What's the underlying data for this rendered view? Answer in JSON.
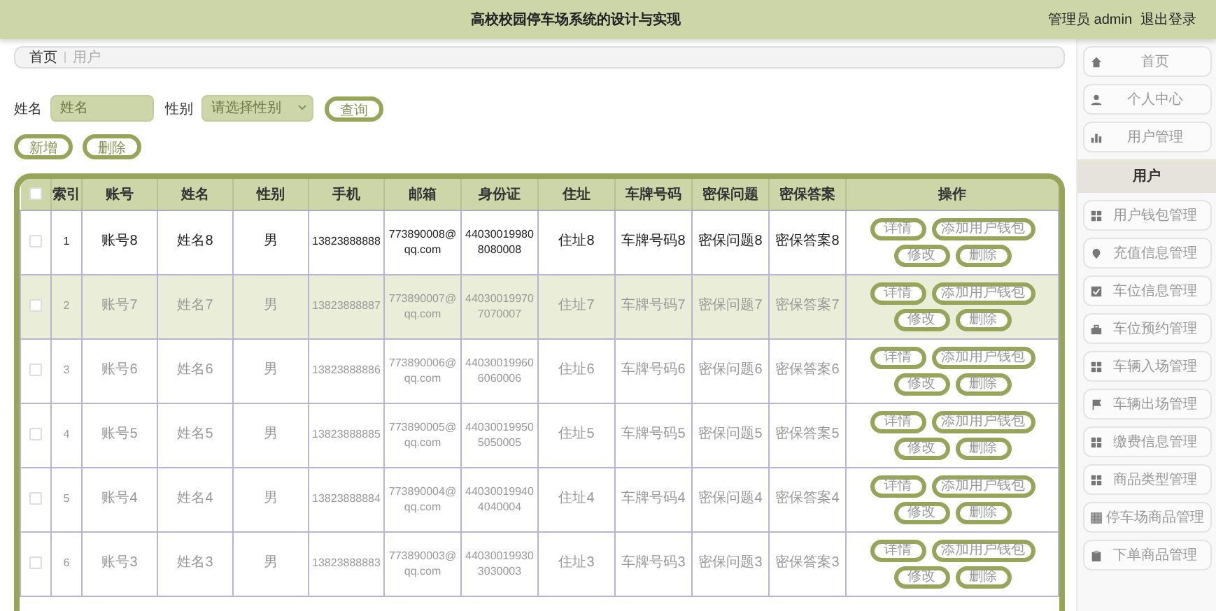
{
  "header": {
    "title": "高校校园停车场系统的设计与实现",
    "user_label": "管理员 admin",
    "logout": "退出登录"
  },
  "breadcrumb": [
    {
      "label": "首页"
    },
    {
      "label": "用户"
    }
  ],
  "search": {
    "fields": [
      {
        "kind": "text",
        "label": "姓名",
        "placeholder": "姓名"
      },
      {
        "kind": "select",
        "label": "性别",
        "placeholder": "请选择性别"
      }
    ],
    "button": "查询"
  },
  "actions": [
    "新增",
    "删除"
  ],
  "table": {
    "select_all": {
      "checked": false
    },
    "columns": [
      "索引",
      "账号",
      "姓名",
      "性别",
      "手机",
      "邮箱",
      "身份证",
      "住址",
      "车牌号码",
      "密保问题",
      "密保答案",
      "操作"
    ],
    "rows": [
      {
        "checked": false,
        "highlighted": true,
        "shaded": false,
        "cells": [
          "1",
          "账号8",
          "姓名8",
          "男",
          "13823888888",
          "773890008@qq.com",
          "440300199808080008",
          "住址8",
          "车牌号码8",
          "密保问题8",
          "密保答案8"
        ],
        "buttons": [
          "详情",
          "添加用户钱包",
          "修改",
          "删除"
        ]
      },
      {
        "checked": false,
        "highlighted": false,
        "shaded": true,
        "cells": [
          "2",
          "账号7",
          "姓名7",
          "男",
          "13823888887",
          "773890007@qq.com",
          "440300199707070007",
          "住址7",
          "车牌号码7",
          "密保问题7",
          "密保答案7"
        ],
        "buttons": [
          "详情",
          "添加用户钱包",
          "修改",
          "删除"
        ]
      },
      {
        "checked": false,
        "highlighted": false,
        "shaded": false,
        "cells": [
          "3",
          "账号6",
          "姓名6",
          "男",
          "13823888886",
          "773890006@qq.com",
          "440300199606060006",
          "住址6",
          "车牌号码6",
          "密保问题6",
          "密保答案6"
        ],
        "buttons": [
          "详情",
          "添加用户钱包",
          "修改",
          "删除"
        ]
      },
      {
        "checked": false,
        "highlighted": false,
        "shaded": false,
        "cells": [
          "4",
          "账号5",
          "姓名5",
          "男",
          "13823888885",
          "773890005@qq.com",
          "440300199505050005",
          "住址5",
          "车牌号码5",
          "密保问题5",
          "密保答案5"
        ],
        "buttons": [
          "详情",
          "添加用户钱包",
          "修改",
          "删除"
        ]
      },
      {
        "checked": false,
        "highlighted": false,
        "shaded": false,
        "cells": [
          "5",
          "账号4",
          "姓名4",
          "男",
          "13823888884",
          "773890004@qq.com",
          "440300199404040004",
          "住址4",
          "车牌号码4",
          "密保问题4",
          "密保答案4"
        ],
        "buttons": [
          "详情",
          "添加用户钱包",
          "修改",
          "删除"
        ]
      },
      {
        "checked": false,
        "highlighted": false,
        "shaded": false,
        "cells": [
          "6",
          "账号3",
          "姓名3",
          "男",
          "13823888883",
          "773890003@qq.com",
          "440300199303030003",
          "住址3",
          "车牌号码3",
          "密保问题3",
          "密保答案3"
        ],
        "buttons": [
          "详情",
          "添加用户钱包",
          "修改",
          "删除"
        ]
      }
    ]
  },
  "sidebar": {
    "items": [
      {
        "kind": "item",
        "label": "首页",
        "selected": false
      },
      {
        "kind": "item",
        "label": "个人中心",
        "selected": false
      },
      {
        "kind": "item",
        "label": "用户管理",
        "selected": false
      },
      {
        "kind": "sub",
        "label": "用户",
        "selected": true
      },
      {
        "kind": "item",
        "label": "用户钱包管理",
        "selected": false
      },
      {
        "kind": "item",
        "label": "充值信息管理",
        "selected": false
      },
      {
        "kind": "item",
        "label": "车位信息管理",
        "selected": false
      },
      {
        "kind": "item",
        "label": "车位预约管理",
        "selected": false
      },
      {
        "kind": "item",
        "label": "车辆入场管理",
        "selected": false
      },
      {
        "kind": "item",
        "label": "车辆出场管理",
        "selected": false
      },
      {
        "kind": "item",
        "label": "缴费信息管理",
        "selected": false
      },
      {
        "kind": "item",
        "label": "商品类型管理",
        "selected": false
      },
      {
        "kind": "item",
        "label": "停车场商品管理",
        "selected": false
      },
      {
        "kind": "item",
        "label": "下单商品管理",
        "selected": false
      }
    ]
  }
}
